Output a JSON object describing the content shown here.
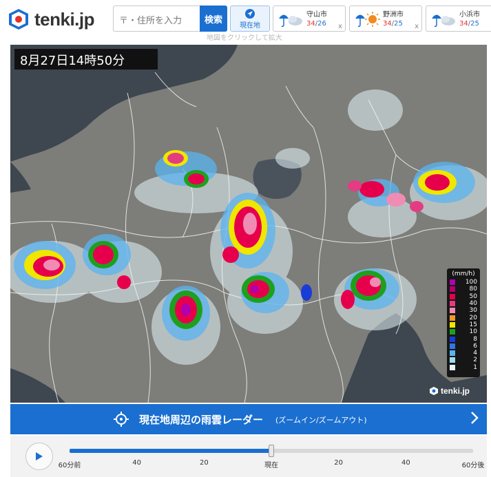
{
  "header": {
    "logo_text": "tenki.jp",
    "search_placeholder": "〒・住所を入力",
    "search_button": "検索",
    "location_button": "現在地",
    "map_hint": "地図をクリックして拡大",
    "cities": [
      {
        "name": "守山市",
        "high": "34",
        "low": "26",
        "weather_icon": "rain-cloud-icon",
        "close": "x"
      },
      {
        "name": "野洲市",
        "high": "34",
        "low": "25",
        "weather_icon": "rain-sun-icon",
        "close": "x"
      },
      {
        "name": "小浜市",
        "high": "34",
        "low": "25",
        "weather_icon": "rain-cloud-icon",
        "close": "x"
      }
    ]
  },
  "map": {
    "timestamp": "8月27日14時50分",
    "watermark": "tenki.jp",
    "legend_unit": "(mm/h)",
    "legend": [
      {
        "label": "100",
        "color": "#b000b0"
      },
      {
        "label": "80",
        "color": "#b4006e"
      },
      {
        "label": "50",
        "color": "#e6004c"
      },
      {
        "label": "40",
        "color": "#e43c82"
      },
      {
        "label": "30",
        "color": "#f08cb4"
      },
      {
        "label": "20",
        "color": "#f09a2a"
      },
      {
        "label": "15",
        "color": "#f0e600"
      },
      {
        "label": "10",
        "color": "#1ea01e"
      },
      {
        "label": "8",
        "color": "#1a3cd6"
      },
      {
        "label": "6",
        "color": "#2d78e6"
      },
      {
        "label": "4",
        "color": "#5ab4f0"
      },
      {
        "label": "2",
        "color": "#a0dcf0"
      },
      {
        "label": "1",
        "color": "#e6f6fa"
      }
    ]
  },
  "banner": {
    "title": "現在地周辺の雨雲レーダー",
    "subtitle": "(ズームイン/ズームアウト)"
  },
  "timeline": {
    "progress_fraction": 0.5,
    "labels": [
      "60分前",
      "40",
      "20",
      "現在",
      "20",
      "40",
      "60分後"
    ]
  },
  "colors": {
    "accent": "#1a6fd0",
    "high_temp": "#e0322c",
    "low_temp": "#1a6fd0"
  }
}
